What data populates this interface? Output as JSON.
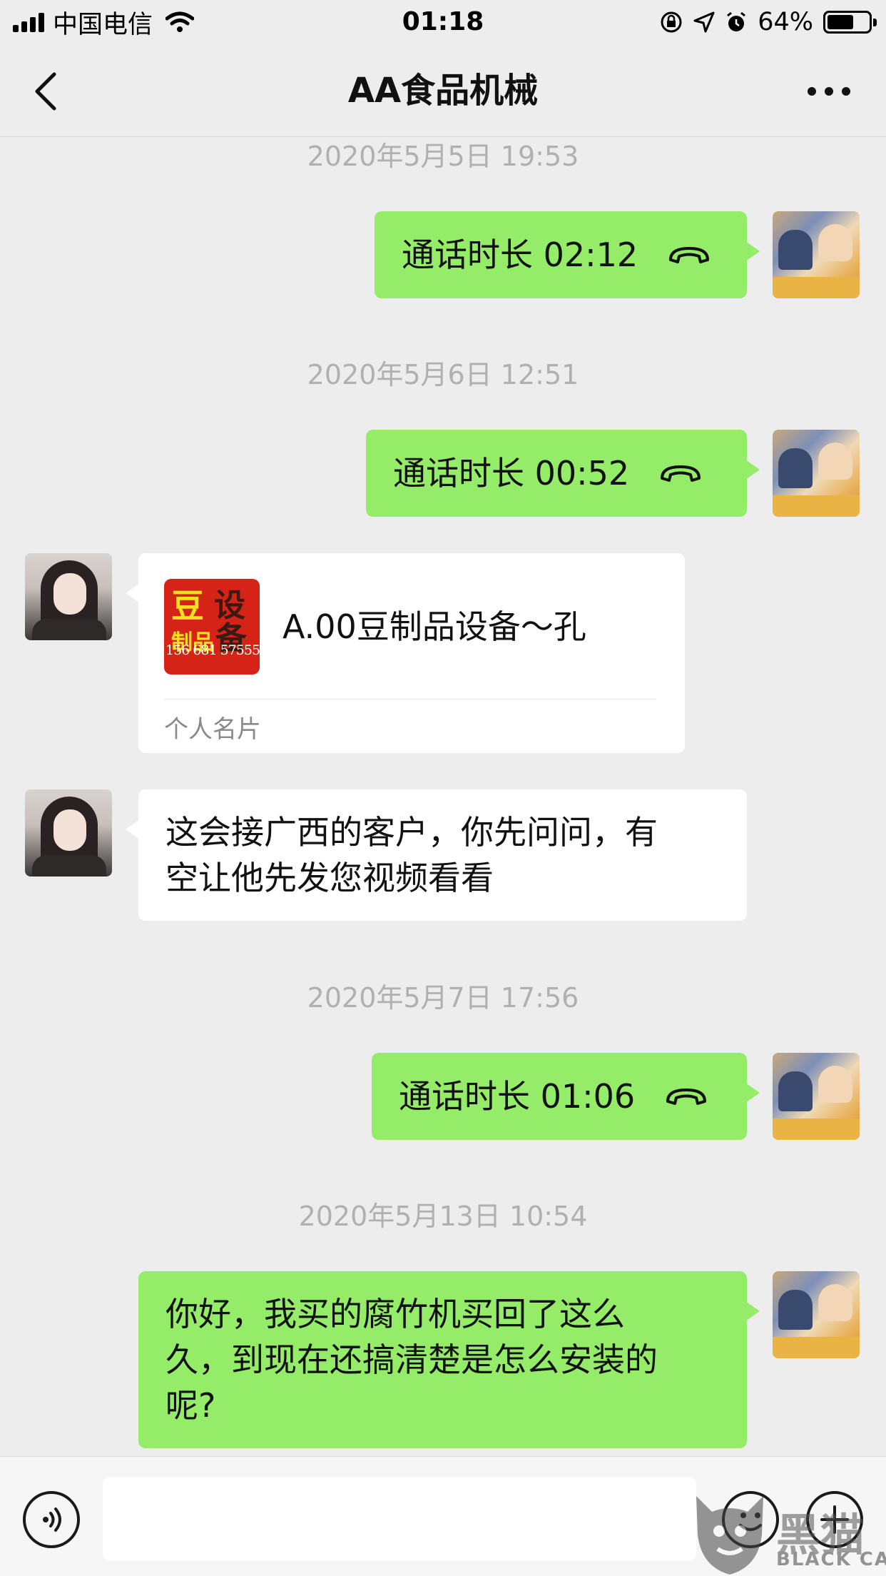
{
  "status_bar": {
    "carrier": "中国电信",
    "time": "01:18",
    "battery": "64%",
    "battery_level": 0.64,
    "icons": [
      "signal-icon",
      "wifi-icon",
      "rotation-lock-icon",
      "location-icon",
      "alarm-icon",
      "battery-icon"
    ]
  },
  "nav": {
    "title": "AA食品机械",
    "back_icon": "chevron-left-icon",
    "more_icon": "more-dots-icon"
  },
  "messages": {
    "ts1": "2020年5月5日 19:53",
    "call1": "通话时长 02:12",
    "ts2": "2020年5月6日 12:51",
    "call2": "通话时长 00:52",
    "card": {
      "name": "A.00豆制品设备～孔",
      "label": "个人名片",
      "logo_chars": [
        "豆",
        "设",
        "制品",
        "备",
        "156 681 57555"
      ]
    },
    "text1_line1": "这会接广西的客户，你先问问，有",
    "text1_line2": "空让他先发您视频看看",
    "ts3": "2020年5月7日 17:56",
    "call3": "通话时长 01:06",
    "ts4": "2020年5月13日 10:54",
    "text2_line1": "你好，我买的腐竹机买回了这么",
    "text2_line2": "久，到现在还搞清楚是怎么安装的",
    "text2_line3": "呢?"
  },
  "watermark": {
    "cn": "黑猫",
    "en": "BLACK CAT"
  },
  "colors": {
    "background": "#ededed",
    "bubble_self": "#95ec69",
    "bubble_other": "#ffffff",
    "timestamp": "#b0b0b0"
  }
}
